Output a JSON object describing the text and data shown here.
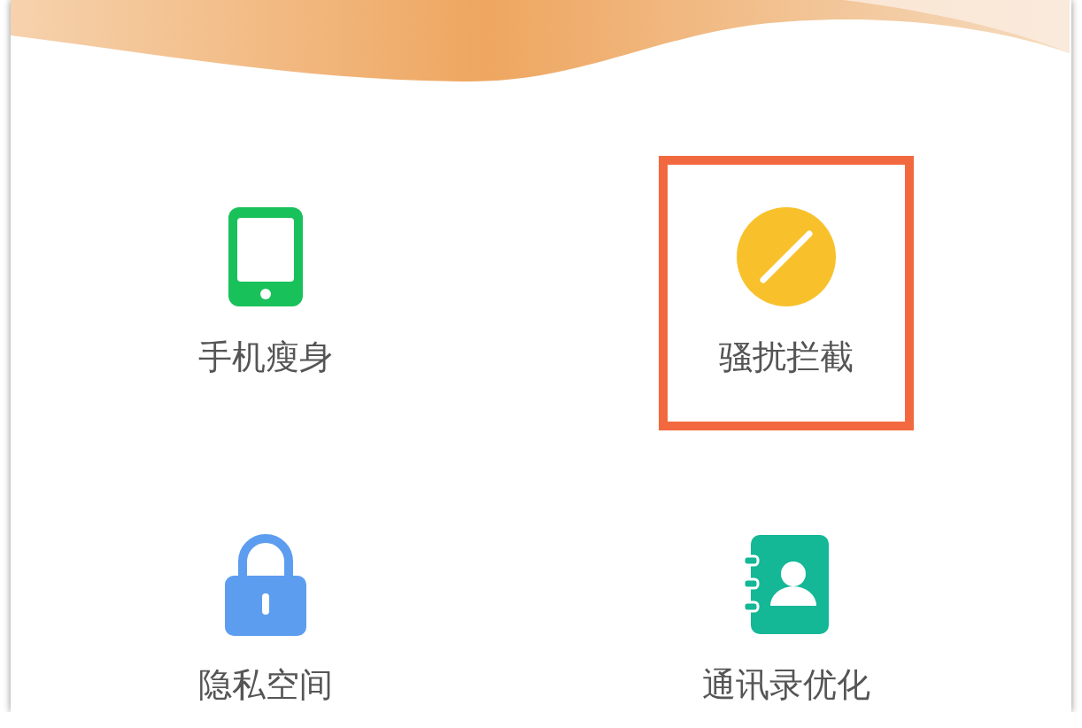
{
  "tiles": [
    {
      "label": "手机瘦身",
      "kind": "phone",
      "highlighted": false
    },
    {
      "label": "骚扰拦截",
      "kind": "block",
      "highlighted": true
    },
    {
      "label": "隐私空间",
      "kind": "lock",
      "highlighted": false
    },
    {
      "label": "通讯录优化",
      "kind": "contacts",
      "highlighted": false
    }
  ]
}
